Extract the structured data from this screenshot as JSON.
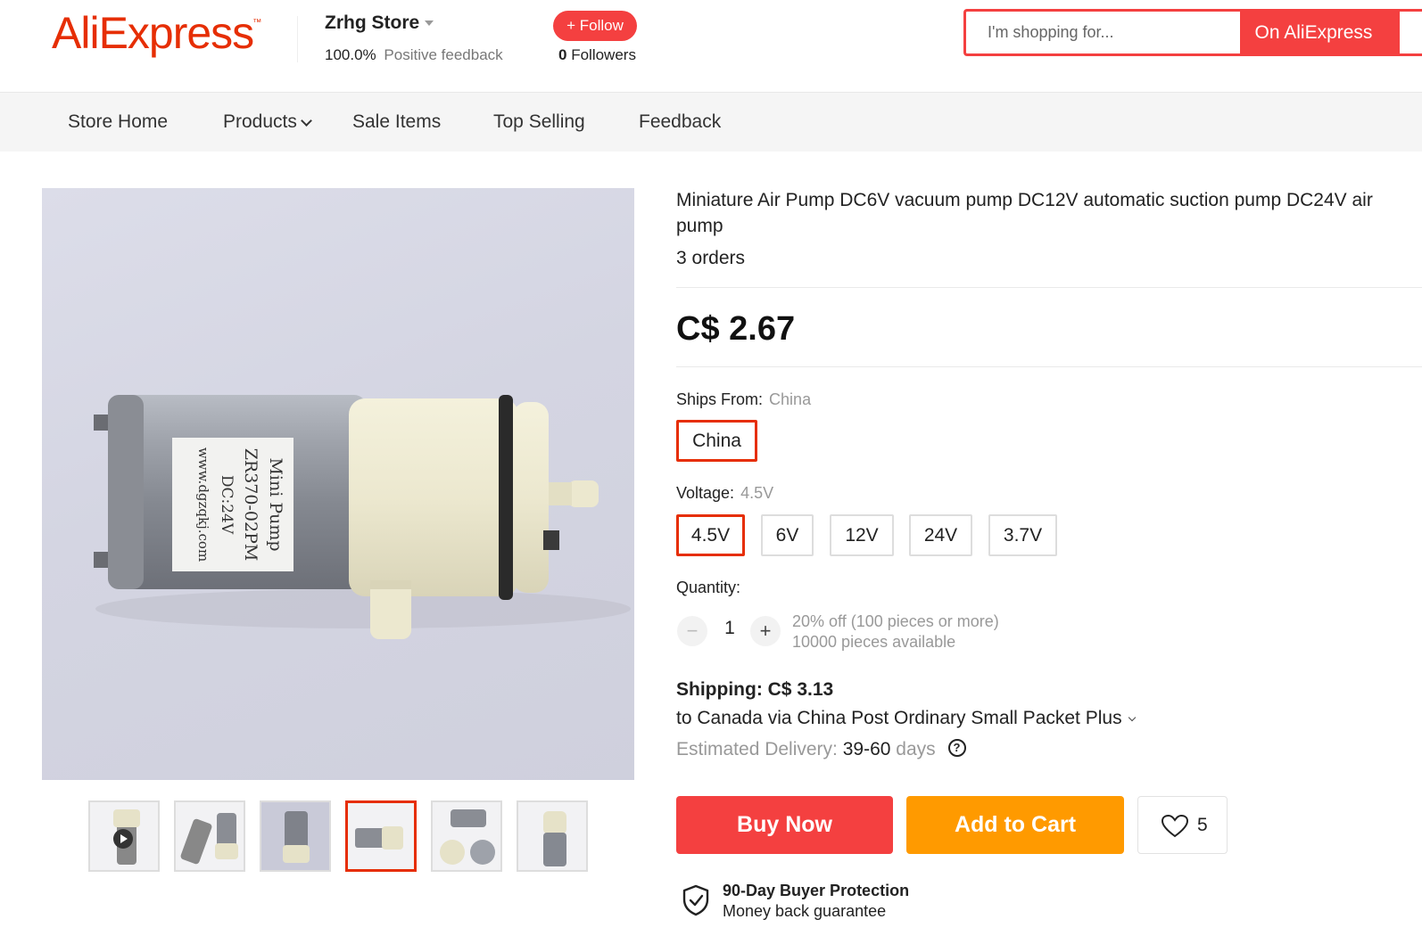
{
  "header": {
    "logo_text": "AliExpress",
    "logo_tm": "™",
    "store_name": "Zrhg Store",
    "feedback_pct": "100.0%",
    "feedback_label": "Positive feedback",
    "follow_label": "+ Follow",
    "followers_count": "0",
    "followers_label": "Followers",
    "search_placeholder": "I'm shopping for...",
    "search_button": "On AliExpress"
  },
  "nav": {
    "items": [
      {
        "label": "Store Home"
      },
      {
        "label": "Products"
      },
      {
        "label": "Sale Items"
      },
      {
        "label": "Top Selling"
      },
      {
        "label": "Feedback"
      }
    ]
  },
  "gallery": {
    "label_lines": [
      "Mini Pump",
      "ZR370-02PM",
      "DC:24V",
      "www.dgzqkj.com"
    ],
    "thumbnails": 6,
    "active_thumbnail": 4
  },
  "product": {
    "title": "Miniature Air Pump DC6V vacuum pump DC12V automatic suction pump DC24V air pump",
    "orders": "3 orders",
    "price": "C$ 2.67",
    "ships_from_label": "Ships From:",
    "ships_from_value": "China",
    "ships_from_options": [
      "China"
    ],
    "voltage_label": "Voltage:",
    "voltage_value": "4.5V",
    "voltage_options": [
      "4.5V",
      "6V",
      "12V",
      "24V",
      "3.7V"
    ],
    "quantity_label": "Quantity:",
    "quantity_value": "1",
    "quantity_minus": "−",
    "quantity_plus": "+",
    "discount_note": "20% off (100 pieces or more)",
    "available_note": "10000 pieces available",
    "shipping_cost": "Shipping: C$ 3.13",
    "shipping_route": "to Canada via China Post Ordinary Small Packet Plus",
    "delivery_label": "Estimated Delivery:",
    "delivery_days": "39-60",
    "delivery_unit": "days",
    "help_glyph": "?",
    "buy_now": "Buy Now",
    "add_to_cart": "Add to Cart",
    "wishlist_count": "5",
    "protection_title": "90-Day Buyer Protection",
    "protection_sub": "Money back guarantee"
  },
  "colors": {
    "brand_red": "#f44040",
    "accent_orange": "#ff9a00",
    "logo_red": "#e62e04"
  }
}
